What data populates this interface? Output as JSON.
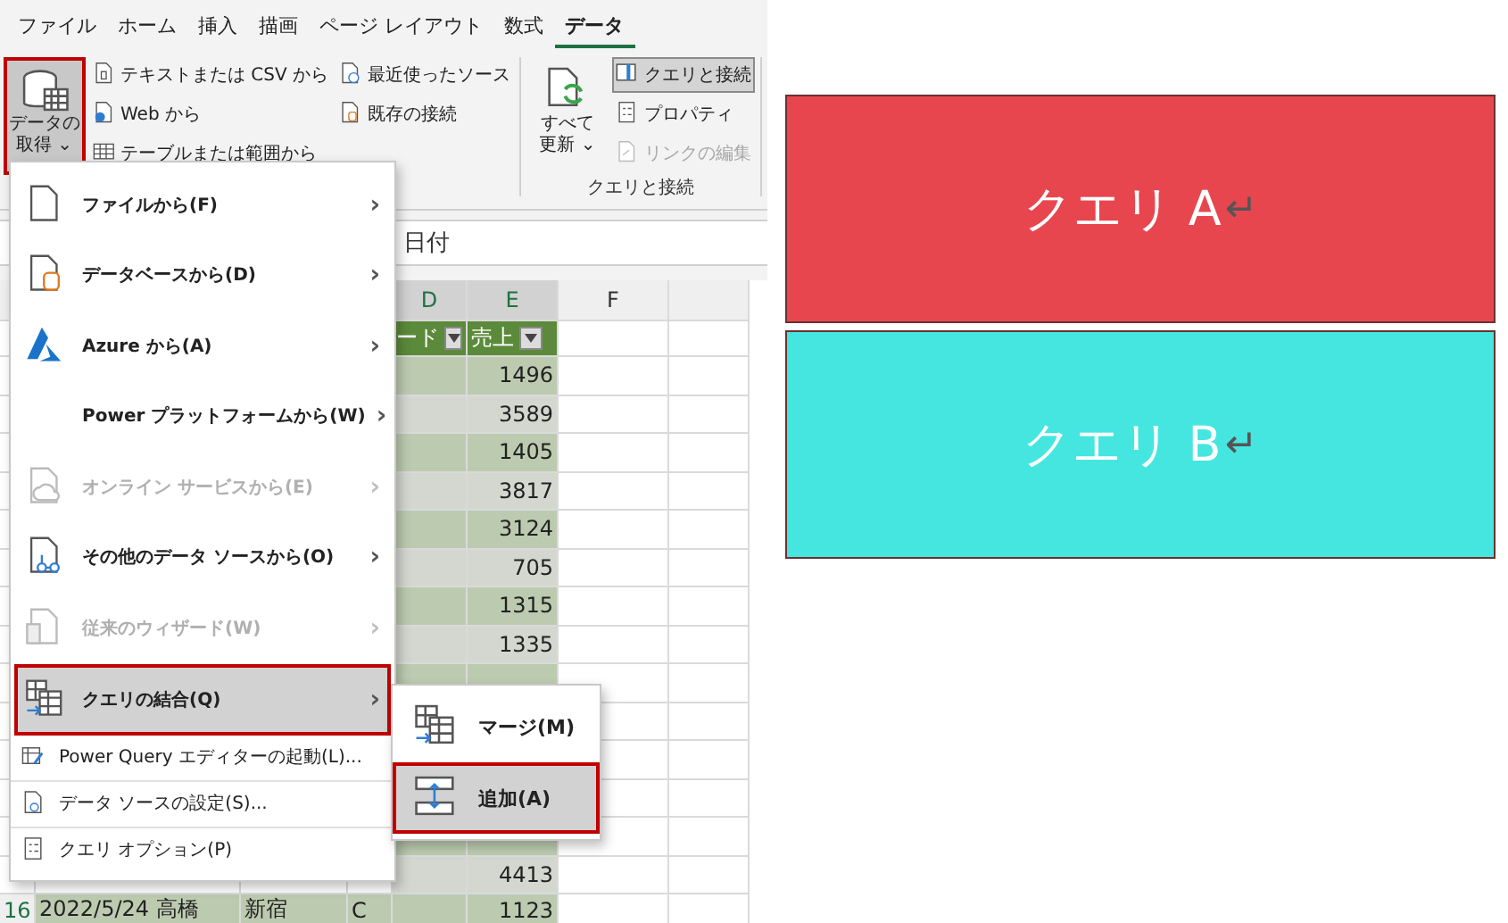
{
  "ribbon_tabs": [
    {
      "label": "ファイル",
      "selected": false
    },
    {
      "label": "ホーム",
      "selected": false
    },
    {
      "label": "挿入",
      "selected": false
    },
    {
      "label": "描画",
      "selected": false
    },
    {
      "label": "ページ レイアウト",
      "selected": false
    },
    {
      "label": "数式",
      "selected": false
    },
    {
      "label": "データ",
      "selected": true
    }
  ],
  "ribbon": {
    "get_data": {
      "line_1": "データの",
      "line_2": "取得",
      "caret": "⌄",
      "selected": true
    },
    "import_commands": [
      {
        "label": "テキストまたは CSV から",
        "kind": "text-file"
      },
      {
        "label": "Web から",
        "kind": "web-file"
      },
      {
        "label": "テーブルまたは範囲から",
        "kind": "table"
      }
    ],
    "source_commands": [
      {
        "label": "最近使ったソース",
        "kind": "clock-file"
      },
      {
        "label": "既存の接続",
        "kind": "db-file"
      }
    ],
    "refresh_all": {
      "line_1": "すべて",
      "line_2": "更新",
      "caret": "⌄"
    },
    "query_commands": [
      {
        "label": "クエリと接続",
        "kind": "pane",
        "selected": true,
        "disabled": false
      },
      {
        "label": "プロパティ",
        "kind": "props",
        "selected": false,
        "disabled": false
      },
      {
        "label": "リンクの編集",
        "kind": "link-file",
        "selected": false,
        "disabled": true
      }
    ],
    "group_label": "クエリと接続"
  },
  "formula_bar": {
    "value": "日付"
  },
  "sheet": {
    "columns": [
      "D",
      "E",
      "F"
    ],
    "table_headers": [
      {
        "label": "ード"
      },
      {
        "label": "売上"
      }
    ],
    "rows": [
      {
        "sales": "1496"
      },
      {
        "sales": "3589"
      },
      {
        "sales": "1405"
      },
      {
        "sales": "3817"
      },
      {
        "sales": "3124"
      },
      {
        "sales": "705"
      },
      {
        "sales": "1315"
      },
      {
        "sales": "1335"
      },
      {},
      {},
      {},
      {},
      {},
      {
        "sales": "4413"
      }
    ],
    "last_row": {
      "row_header": "16",
      "date_name": "2022/5/24 高橋",
      "store": "新宿",
      "code": "C",
      "sales": "1123"
    }
  },
  "menu": {
    "items": [
      {
        "label": "ファイルから(F)",
        "kind": "file",
        "disabled": false,
        "selected": false
      },
      {
        "label": "データベースから(D)",
        "kind": "database",
        "disabled": false,
        "selected": false
      },
      {
        "label": "Azure から(A)",
        "kind": "azure",
        "disabled": false,
        "selected": false
      },
      {
        "label": "Power プラットフォームから(W)",
        "kind": "none",
        "disabled": false,
        "selected": false
      },
      {
        "label": "オンライン サービスから(E)",
        "kind": "cloud",
        "disabled": true,
        "selected": false
      },
      {
        "label": "その他のデータ ソースから(O)",
        "kind": "other",
        "disabled": false,
        "selected": false
      },
      {
        "label": "従来のウィザード(W)",
        "kind": "wizard",
        "disabled": true,
        "selected": false
      },
      {
        "label": "クエリの結合(Q)",
        "kind": "combine",
        "disabled": false,
        "selected": true
      }
    ],
    "footer_items": [
      {
        "label": "Power Query エディターの起動(L)...",
        "kind": "editor"
      },
      {
        "label": "データ ソースの設定(S)...",
        "kind": "settings-file"
      },
      {
        "label": "クエリ オプション(P)",
        "kind": "props"
      }
    ],
    "submenu_arrow": "›"
  },
  "submenu": {
    "items": [
      {
        "label": "マージ(M)",
        "kind": "merge",
        "selected": false
      },
      {
        "label": "追加(A)",
        "kind": "append",
        "selected": true
      }
    ]
  },
  "query_boxes": [
    {
      "label": "クエリ A",
      "mark": "↵",
      "color": "#e8464f"
    },
    {
      "label": "クエリ B",
      "mark": "↵",
      "color": "#45e6e0"
    }
  ]
}
